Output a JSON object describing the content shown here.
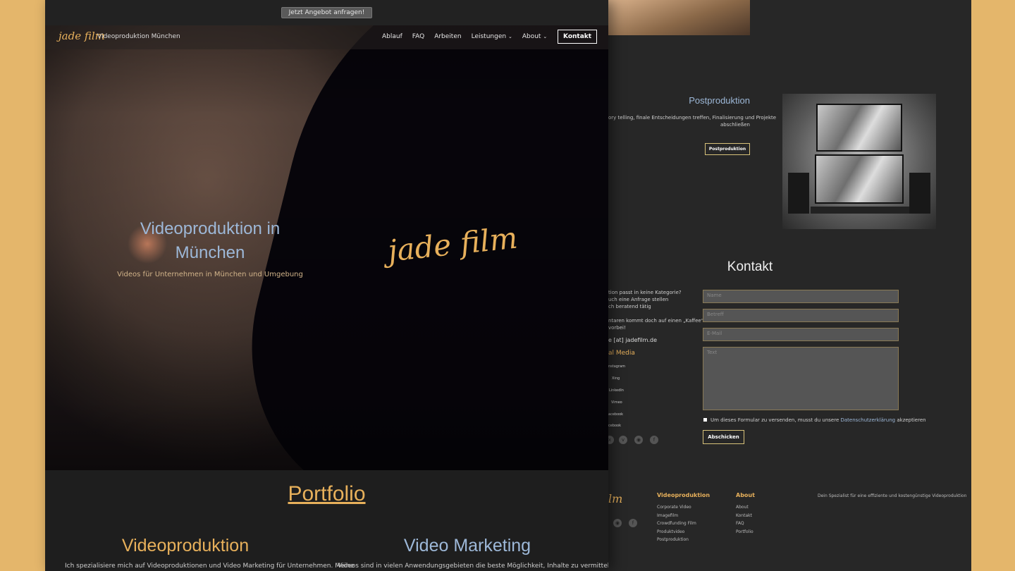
{
  "top_cta": "Jetzt Angebot anfragen!",
  "nav": {
    "logo": "jade film",
    "subtitle": "Videoproduktion München",
    "links": [
      "Ablauf",
      "FAQ",
      "Arbeiten",
      "Leistungen",
      "About"
    ],
    "chevron": "chevron-down-icon",
    "kontakt": "Kontakt"
  },
  "hero": {
    "title": "Videoproduktion in München",
    "subtitle": "Videos für Unternehmen in München und Umgebung",
    "logo": "jade film"
  },
  "portfolio": {
    "heading": "Portfolio",
    "left_title": "Videoproduktion",
    "left_text": "Ich spezialisiere mich auf Videoproduktionen und Video Marketing für Unternehmen. Meine",
    "right_title": "Video Marketing",
    "right_text": "Videos sind in vielen Anwendungsgebieten die beste Möglichkeit, Inhalte zu vermitteln und"
  },
  "back": {
    "post_title": "Postproduktion",
    "post_text_1": "ory telling, finale Entscheidungen treffen, Finalisierung und Projekte",
    "post_text_2": "abschließen",
    "post_button": "Postproduktion",
    "kontakt_title": "Kontakt",
    "contact_lines": [
      "tion passt in keine Kategorie?",
      "uch eine Anfrage stellen",
      "ch beratend tätig",
      "ntaren kommt doch auf einen „Kaffee“",
      "vorbei!"
    ],
    "email": "e [at] jadefilm.de",
    "social_title": "al Media",
    "social_links": [
      "nstagram",
      "Xing",
      "LinkedIn",
      "Vimeo",
      "acebook",
      "cebook"
    ],
    "fields": [
      "Name",
      "Betreff",
      "E-Mail",
      "Text"
    ],
    "consent_prefix": "Um dieses Formular zu versenden, musst du unsere ",
    "consent_link": "Datenschutzerklärung",
    "consent_suffix": " akzeptieren",
    "submit": "Abschicken",
    "footer_logo": "lm",
    "footer_col1_title": "Videoproduktion",
    "footer_col1": [
      "Corporate Video",
      "Imagefilm",
      "Crowdfunding Film",
      "Produktvideo",
      "Postproduktion"
    ],
    "footer_col2_title": "About",
    "footer_col2": [
      "About",
      "Kontakt",
      "FAQ",
      "Portfolio"
    ],
    "footer_tagline": "Dein Spezialist für eine effiziente und kostengünstige Videoproduktion"
  },
  "colors": {
    "accent": "#e7b05b",
    "blue": "#9db8d8",
    "background": "#e4b66b"
  }
}
